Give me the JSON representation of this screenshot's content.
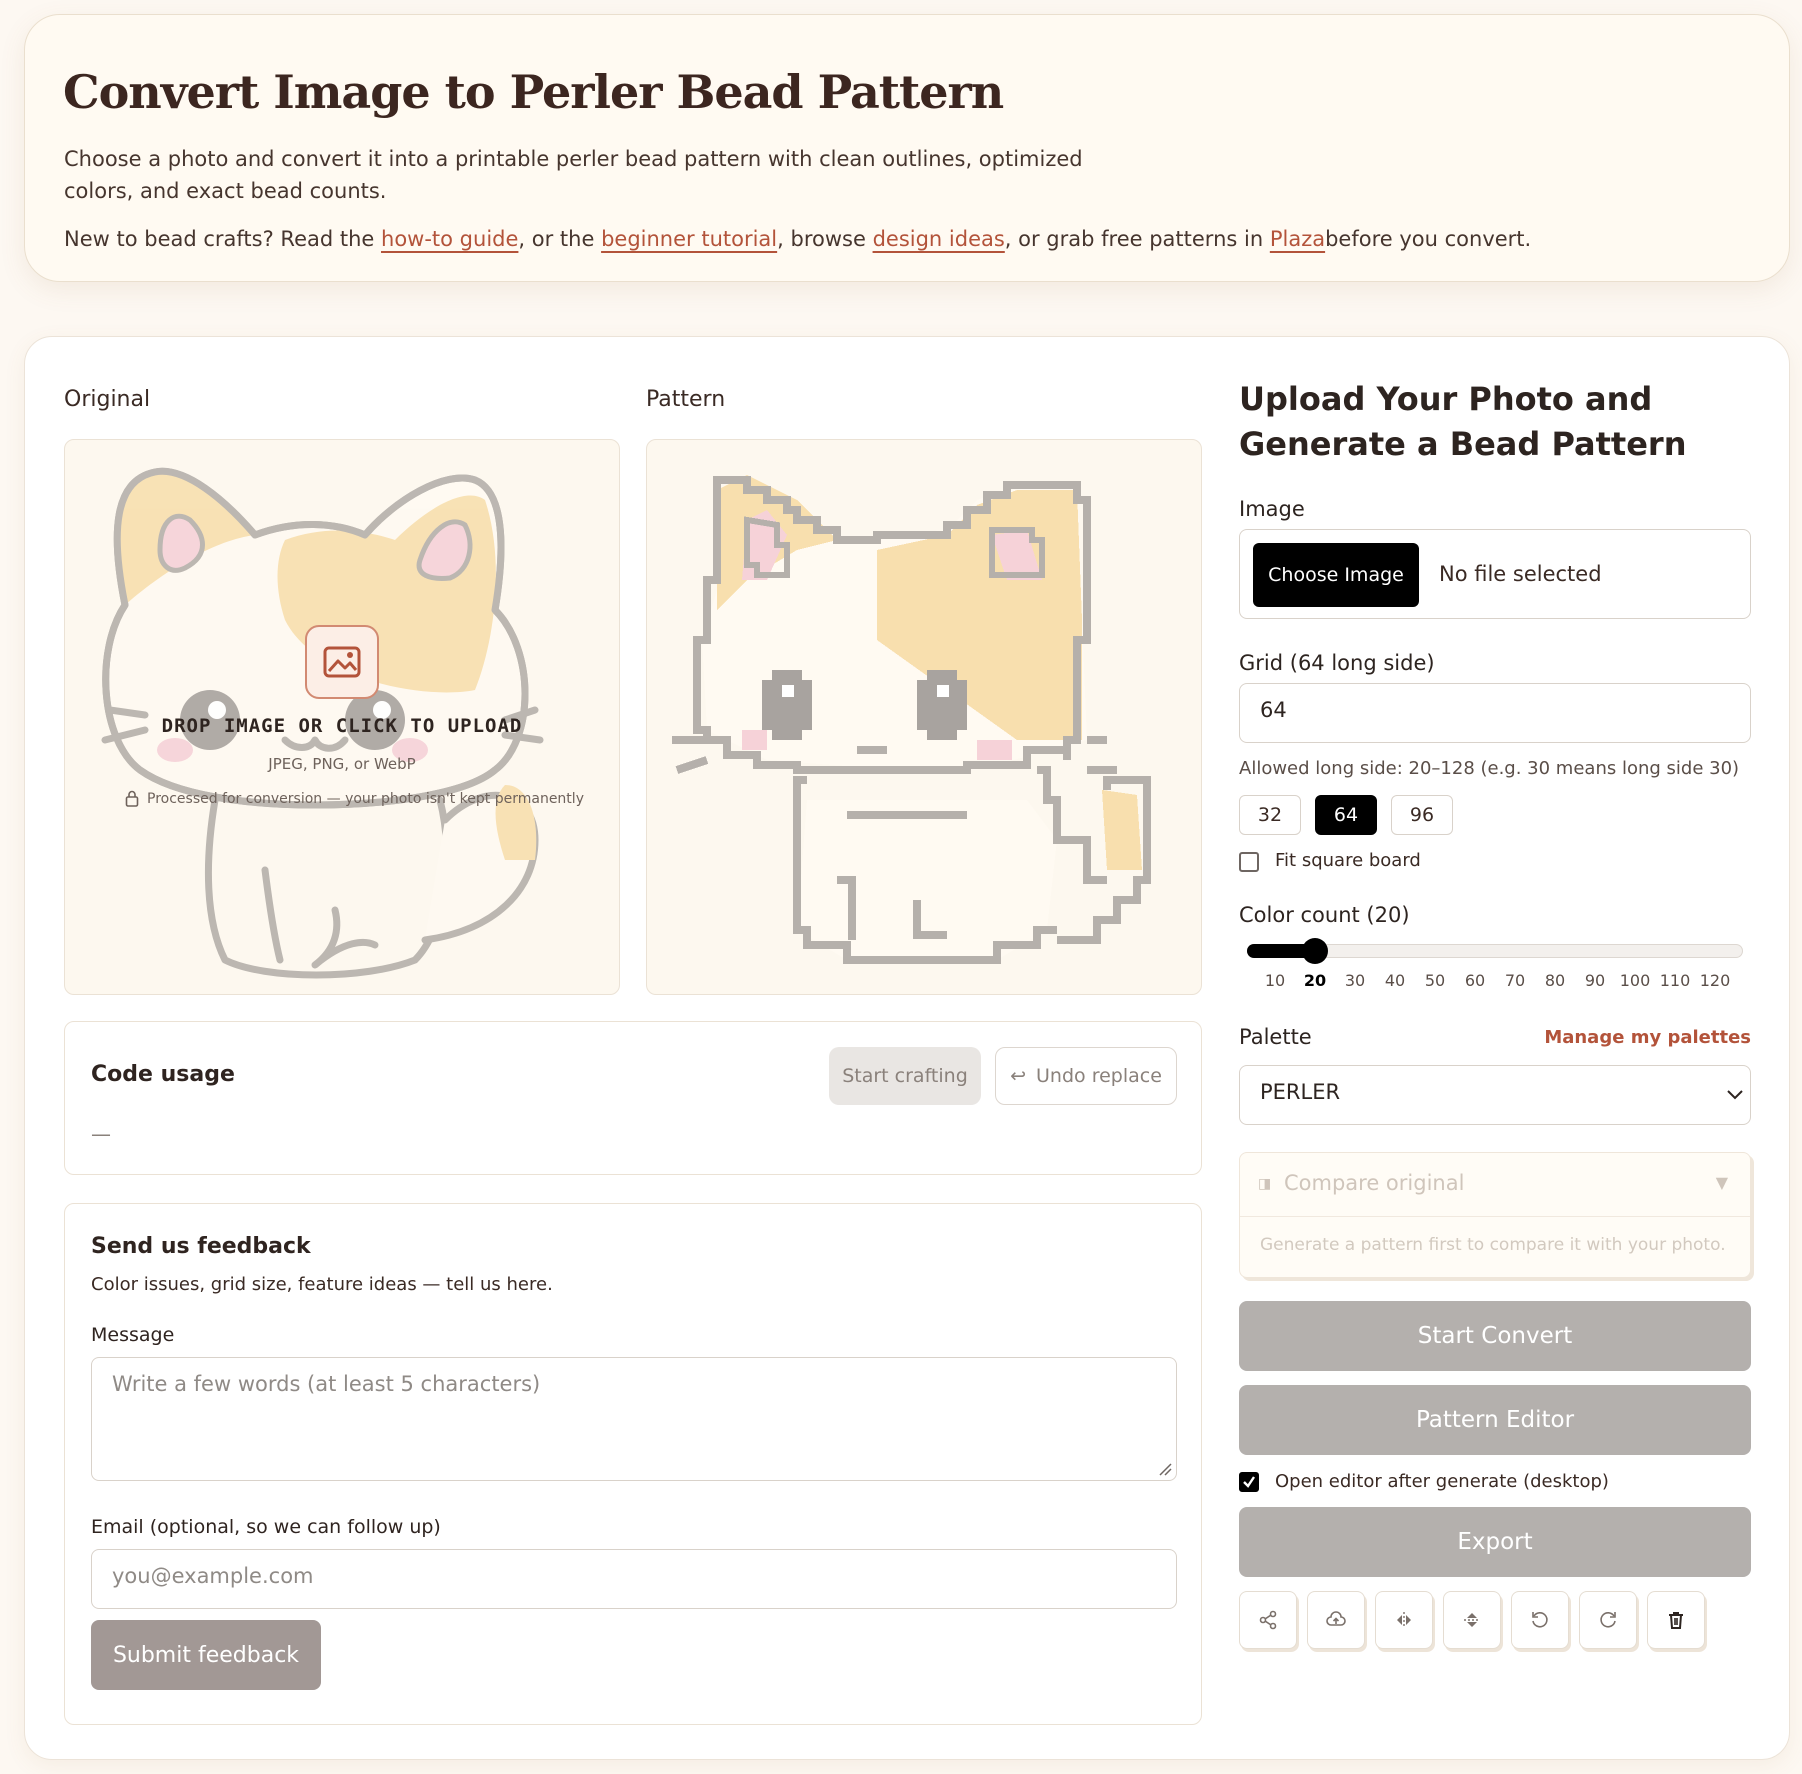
{
  "hero": {
    "title": "Convert Image to Perler Bead Pattern",
    "description": "Choose a photo and convert it into a printable perler bead pattern with clean outlines, optimized colors, and exact bead counts.",
    "links_prefix": "New to bead crafts? Read the ",
    "link_howto": "how-to guide",
    "links_mid1": ", or the ",
    "link_tutorial": "beginner tutorial",
    "links_mid2": ", browse ",
    "link_ideas": "design ideas",
    "links_mid3": ", or grab free patterns in ",
    "link_plaza": "Plaza",
    "links_suffix": "before you convert."
  },
  "preview": {
    "original_label": "Original",
    "pattern_label": "Pattern",
    "drop_title": "DROP IMAGE OR CLICK TO UPLOAD",
    "drop_formats": "JPEG, PNG, or WebP",
    "drop_privacy": "Processed for conversion — your photo isn't kept permanently"
  },
  "code_usage": {
    "title": "Code usage",
    "start_crafting": "Start crafting",
    "undo_replace": "Undo replace",
    "empty": "—"
  },
  "feedback": {
    "title": "Send us feedback",
    "subtitle": "Color issues, grid size, feature ideas — tell us here.",
    "message_label": "Message",
    "message_placeholder": "Write a few words (at least 5 characters)",
    "email_label": "Email (optional, so we can follow up)",
    "email_placeholder": "you@example.com",
    "submit": "Submit feedback"
  },
  "sidebar": {
    "title": "Upload Your Photo and Generate a Bead Pattern",
    "image_label": "Image",
    "choose_image": "Choose Image",
    "no_file": "No file selected",
    "grid_label": "Grid (64 long side)",
    "grid_value": "64",
    "grid_help": "Allowed long side: 20–128 (e.g. 30 means long side 30)",
    "grid_presets": [
      "32",
      "64",
      "96"
    ],
    "grid_active": "64",
    "fit_square": "Fit square board",
    "fit_square_checked": false,
    "color_count_label": "Color count (20)",
    "color_count_value": 20,
    "color_count_min": 10,
    "color_count_max": 120,
    "color_ticks": [
      "10",
      "20",
      "30",
      "40",
      "50",
      "60",
      "70",
      "80",
      "90",
      "100",
      "110",
      "120"
    ],
    "palette_label": "Palette",
    "manage_palettes": "Manage my palettes",
    "palette_value": "PERLER",
    "compare_title": "Compare original",
    "compare_hint": "Generate a pattern first to compare it with your photo.",
    "start_convert": "Start Convert",
    "pattern_editor": "Pattern Editor",
    "open_editor_label": "Open editor after generate (desktop)",
    "open_editor_checked": true,
    "export": "Export",
    "tools": [
      "share-icon",
      "cloud-upload-icon",
      "flip-horizontal-icon",
      "flip-vertical-icon",
      "rotate-left-icon",
      "rotate-right-icon",
      "trash-icon"
    ]
  },
  "colors": {
    "accent_link": "#b3533a",
    "primary_dark": "#000000",
    "disabled_button": "#b4b0ad",
    "submit_button": "#a29895",
    "cat_fur": "#f8dfae",
    "cat_ear": "#f6d2d8",
    "outline": "#b5b0ab"
  }
}
